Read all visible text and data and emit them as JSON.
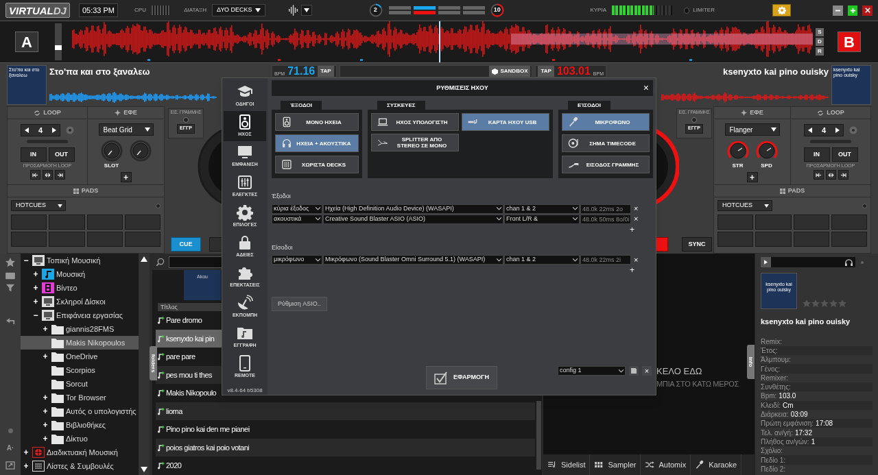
{
  "top_bar": {
    "logo": {
      "part1": "VIRTUAL",
      "part2": "DJ"
    },
    "time": "05:33 PM",
    "cpu_label": "CPU",
    "layout_label": "ΔΙΑΤΑΞΗ",
    "layout_value": "ΔΥΟ DECKS",
    "left_count": "2",
    "right_count": "10",
    "crossfader_blocks": [
      {
        "active": false
      },
      {
        "active": true
      },
      {
        "active": false
      },
      {
        "active": false
      }
    ],
    "master_label": "ΚΥΡΙΑ",
    "master_meter": {
      "level": 0.7
    },
    "limiter_label": "LIMITER"
  },
  "overview": {
    "decks": [
      {
        "letter": "A",
        "color": "#333333"
      },
      {
        "letter": "B",
        "color": "#e01010"
      }
    ],
    "pitch_slider": {
      "level": 0.33
    },
    "buttons": [
      "S",
      "D",
      "R"
    ]
  },
  "decks": [
    {
      "title": "Στο'πα και στο ξαναλεω",
      "cover_text": "Στο'πα και στο ξαναλεω",
      "bpm_label": "BPM",
      "bpm": "71.16",
      "tap": "TAP",
      "color": "#19a7f0"
    },
    {
      "title": "ksenyxto kai pino ouisky",
      "cover_text": "ksenyxto kai pino ouisky",
      "bpm_label": "BPM",
      "bpm": "103.01",
      "tap": "TAP",
      "color": "#ee1111"
    }
  ],
  "sandbox": "SANDBOX",
  "deck_controls": [
    {
      "loop_label": "LOOP",
      "fx_label": "ΕΦΕ",
      "loop_length": "4",
      "loop_in": "IN",
      "loop_out": "OUT",
      "loop_adjust": "ΠΡΟΣΑΡΜΟΓΗ LOOP",
      "effect": "Beat Grid",
      "knobs": [
        {
          "label": "SLOT",
          "active": false
        },
        {
          "active": false
        }
      ],
      "add": "+",
      "line_in": "ΕΙΣ. ΓΡΑΜΜΗΣ",
      "record": "ΕΓΓΡ",
      "pads_label": "PADS",
      "pads_mode": "HOTCUES",
      "transport": {
        "kind": "cue",
        "label": "CUE"
      },
      "playing": false
    },
    {
      "loop_label": "LOOP",
      "fx_label": "ΕΦΕ",
      "loop_length": "4",
      "loop_in": "IN",
      "loop_out": "OUT",
      "loop_adjust": "ΠΡΟΣΑΡΜΟΓΗ LOOP",
      "effect": "Flanger",
      "knobs": [
        {
          "label": "STR",
          "active": true
        },
        {
          "label": "SPD",
          "active": true
        }
      ],
      "add": "+",
      "line_in": "ΕΙΣ. ΓΡΑΜΜΗΣ",
      "record": "ΕΓΓΡ",
      "pads_label": "PADS",
      "pads_mode": "HOTCUES",
      "transport": {
        "kind": "sync",
        "label": "SYNC"
      },
      "playing": true
    }
  ],
  "settings": {
    "title": "ΡΥΘΜΙΣΕΙΣ ΗΧΟΥ",
    "close": "×",
    "nav": [
      {
        "label": "ΟΔΗΓΟΙ",
        "kind": "cap",
        "selected": false
      },
      {
        "label": "ΗΧΟΣ",
        "kind": "speaker",
        "selected": true
      },
      {
        "label": "ΕΜΦΑΝΙΣΗ",
        "kind": "monitor",
        "selected": false
      },
      {
        "label": "ΕΛΕΓΚΤΕΣ",
        "kind": "sliders",
        "selected": false
      },
      {
        "label": "ΕΠΙΛΟΓΕΣ",
        "kind": "gear",
        "selected": false
      },
      {
        "label": "ΑΔΕΙΕΣ",
        "kind": "lock",
        "selected": false
      },
      {
        "label": "ΕΠΕΚΤΑΣΕΙΣ",
        "kind": "puzzle",
        "selected": false
      },
      {
        "label": "ΕΚΠΟΜΠΗ",
        "kind": "dish",
        "selected": false
      },
      {
        "label": "ΕΓΓΡΑΦΗ",
        "kind": "folder_music",
        "selected": false
      },
      {
        "label": "REMOTE",
        "kind": "tablet",
        "selected": false
      }
    ],
    "version": "v8.4-64 b5308",
    "groups": [
      {
        "title": "ΈΞΟΔΟΙ",
        "options": [
          {
            "label": "ΜΟΝΟ ΗΧΕΙΑ",
            "kind": "speaker",
            "selected": false
          },
          {
            "label": "ΗΧΕΙΑ + ΑΚΟΥΣΤΙΚΑ",
            "kind": "headphones",
            "selected": true
          },
          {
            "label": "ΧΩΡΙΣΤΑ DECKS",
            "kind": "grid",
            "selected": false
          }
        ]
      },
      {
        "title": "ΣΥΣΚΕΥΕΣ",
        "options": [
          {
            "label": "ΗΧΟΣ ΥΠΟΛΟΓΙΣΤΗ",
            "kind": "laptop",
            "selected": false
          },
          {
            "label": "ΚΑΡΤΑ ΗΧΟΥ USB",
            "kind": "usb",
            "selected": true
          },
          {
            "label": "SPLITTER ΑΠΟ STEREO ΣΕ ΜΟΝΟ",
            "kind": "splitter",
            "selected": false
          }
        ]
      },
      {
        "title": "ΕΊΣΟΔΟΙ",
        "options": [
          {
            "label": "ΜΙΚΡΟΦΩΝΟ",
            "kind": "mic",
            "selected": true
          },
          {
            "label": "ΣΗΜΑ TIMECODE",
            "kind": "turntable",
            "selected": false
          },
          {
            "label": "ΕΙΣΟΔΟΣ ΓΡΑΜΜΗΣ",
            "kind": "cable",
            "selected": false
          }
        ]
      }
    ],
    "outputs_label": "Έξοδοι",
    "outputs": [
      {
        "role": "κύρια έξοδος",
        "device": "Ηχεία (High Definition Audio Device) (WASAPI)",
        "channels": "chan 1 & 2",
        "info": "48.0k 22ms 2o",
        "remove": "×"
      },
      {
        "role": "ακουστικά",
        "device": "Creative Sound Blaster ASIO (ASIO)",
        "channels": "Front L/R &",
        "info": "48.0k 50ms 8o/0i",
        "remove": "×"
      }
    ],
    "outputs_add": "+",
    "inputs_label": "Είσοδοι",
    "inputs": [
      {
        "role": "μικρόφωνο",
        "device": "Μικρόφωνο (Sound Blaster Omni Surround 5.1) (WASAPI)",
        "channels": "chan 1 & 2",
        "info": "48.0k 22ms 2i",
        "remove": "×"
      }
    ],
    "inputs_add": "+",
    "asio_button": "Ρύθμιση ASIO..",
    "apply": "ΕΦΑΡΜΟΓΗ",
    "config": "config 1",
    "config_delete": "×"
  },
  "browser": {
    "tools_label": "A·",
    "tree": [
      {
        "label": "Τοπική Μουσική",
        "kind": "computer",
        "expander": "−",
        "selected": false,
        "children": [
          {
            "label": "Μουσική",
            "kind": "music",
            "expander": "+",
            "selected": false
          },
          {
            "label": "Βίντεο",
            "kind": "video",
            "expander": "+",
            "selected": false
          },
          {
            "label": "Σκληροί Δίσκοι",
            "kind": "computer",
            "expander": "+",
            "selected": false
          },
          {
            "label": "Επιφάνεια εργασίας",
            "kind": "computer",
            "expander": "−",
            "selected": false,
            "children": [
              {
                "label": "giannis28FMS",
                "kind": "folder",
                "expander": "+",
                "selected": false
              },
              {
                "label": "Makis Nikopoulos",
                "kind": "folder",
                "selected": true
              },
              {
                "label": "OneDrive",
                "kind": "folder",
                "expander": "+",
                "selected": false
              },
              {
                "label": "Scorpios",
                "kind": "folder",
                "selected": false
              },
              {
                "label": "Sorcut",
                "kind": "folder",
                "selected": false
              },
              {
                "label": "Tor Browser",
                "kind": "folder",
                "expander": "+",
                "selected": false
              },
              {
                "label": "Αυτός ο υπολογιστής",
                "kind": "folder",
                "expander": "+",
                "selected": false
              },
              {
                "label": "Βιβλιοθήκες",
                "kind": "folder",
                "expander": "+",
                "selected": false
              },
              {
                "label": "Δίκτυο",
                "kind": "folder",
                "expander": "+",
                "selected": false
              }
            ]
          }
        ]
      },
      {
        "label": "Διαδικτυακή Μουσική",
        "kind": "web",
        "expander": "+",
        "selected": false
      },
      {
        "label": "Λίστες & Συμβουλές",
        "kind": "list",
        "expander": "+",
        "selected": false
      }
    ],
    "folders_tab": "folders",
    "cover_text": "Akou",
    "columns": [
      "Τίτλος"
    ],
    "songs": [
      {
        "title": "Pare dromo",
        "selected": false
      },
      {
        "title": "ksenyxto kai pin",
        "selected": true
      },
      {
        "title": "pare pare",
        "selected": false
      },
      {
        "title": "pes mou ti thes",
        "selected": false
      },
      {
        "title": "Makis Nikopoulo",
        "selected": false
      },
      {
        "title": "lioma",
        "selected": false
      },
      {
        "title": "Pino pino kai den me pianei",
        "selected": false
      },
      {
        "title": "poios giatros kai poio votani",
        "selected": false
      },
      {
        "title": "2020",
        "selected": false
      }
    ],
    "drop_hint": [
      "ΚΕΛΟ ΕΔΩ",
      "ΜΠΙΑ ΣΤΟ ΚΑΤΩ ΜΕΡΟΣ"
    ],
    "info_tab": "info",
    "bottom_tabs": [
      {
        "label": "Sidelist",
        "kind": "sidelist"
      },
      {
        "label": "Sampler",
        "kind": "sampler"
      },
      {
        "label": "Automix",
        "kind": "shuffle"
      },
      {
        "label": "Karaoke",
        "kind": "mic"
      }
    ]
  },
  "info": {
    "cover_text": "ksenyxto kai pino ouisky",
    "stars": 0,
    "title": "ksenyxto kai pino ouisky",
    "fields": [
      {
        "label": "Remix:"
      },
      {
        "label": "Έτος:"
      },
      {
        "label": "Άλμπουμ:"
      },
      {
        "label": "Γένος:"
      },
      {
        "label": "Remixer:"
      },
      {
        "label": "Συνθέτης:"
      },
      {
        "label": "Bpm:",
        "value": "103.0"
      },
      {
        "label": "Κλειδί:",
        "value": "Cm"
      },
      {
        "label": "Διάρκεια:",
        "value": "03:09"
      },
      {
        "label": "Πρώτη εμφάνιση:",
        "value": "17:08"
      },
      {
        "label": "Τελ. αν/γή:",
        "value": "17:32"
      },
      {
        "label": "Πλήθος αν/γών:",
        "value": "1"
      },
      {
        "label": "Σχόλιο:"
      },
      {
        "label": "Πεδίο 1:"
      },
      {
        "label": "Πεδίο 2:"
      }
    ]
  }
}
